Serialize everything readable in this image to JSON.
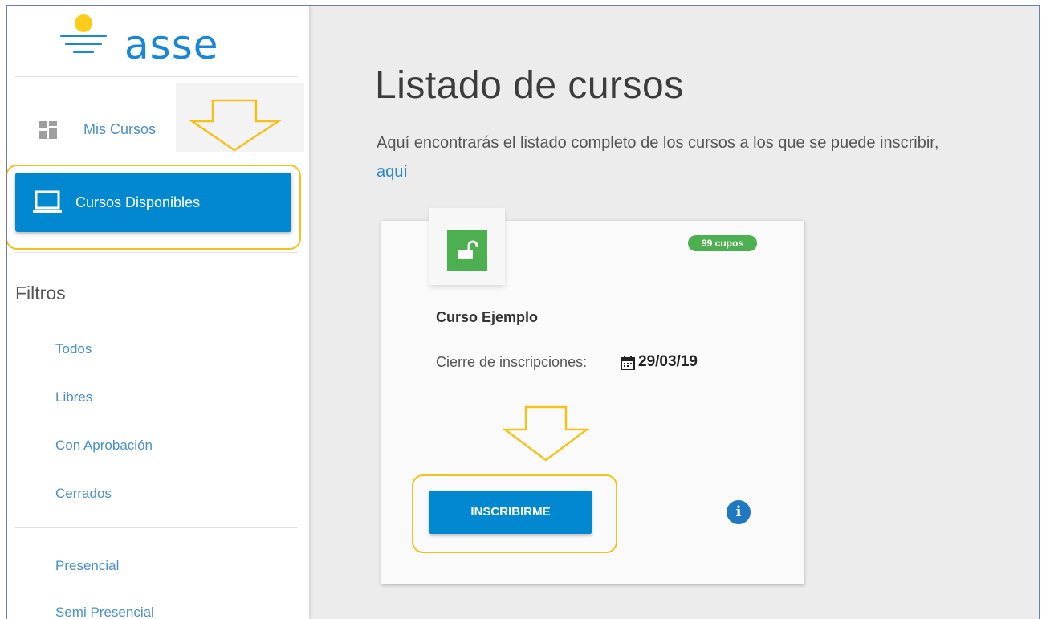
{
  "sidebar": {
    "logo_text": "asse",
    "mis_cursos_label": "Mis Cursos",
    "cursos_disponibles_label": "Cursos Disponibles",
    "filtros_title": "Filtros",
    "filters": [
      "Todos",
      "Libres",
      "Con Aprobación",
      "Cerrados"
    ],
    "modalities": [
      "Presencial",
      "Semi Presencial"
    ]
  },
  "main": {
    "title": "Listado de cursos",
    "description": "Aquí encontrarás el listado completo de los cursos a los que se puede inscribir,",
    "link_text": "aquí"
  },
  "course_card": {
    "badge": "99 cupos",
    "name": "Curso Ejemplo",
    "cierre_label": "Cierre de inscripciones:",
    "date": "29/03/19",
    "button_label": "INSCRIBIRME",
    "info_glyph": "i"
  },
  "icons": [
    "dashboard-icon",
    "laptop-icon",
    "lock-open-icon",
    "calendar-icon",
    "info-icon"
  ],
  "colors": {
    "primary": "#0288d1",
    "success": "#4caf50",
    "highlight": "#f4c21b",
    "logo_blue": "#1a87d6",
    "logo_sun": "#ffcc1a"
  }
}
